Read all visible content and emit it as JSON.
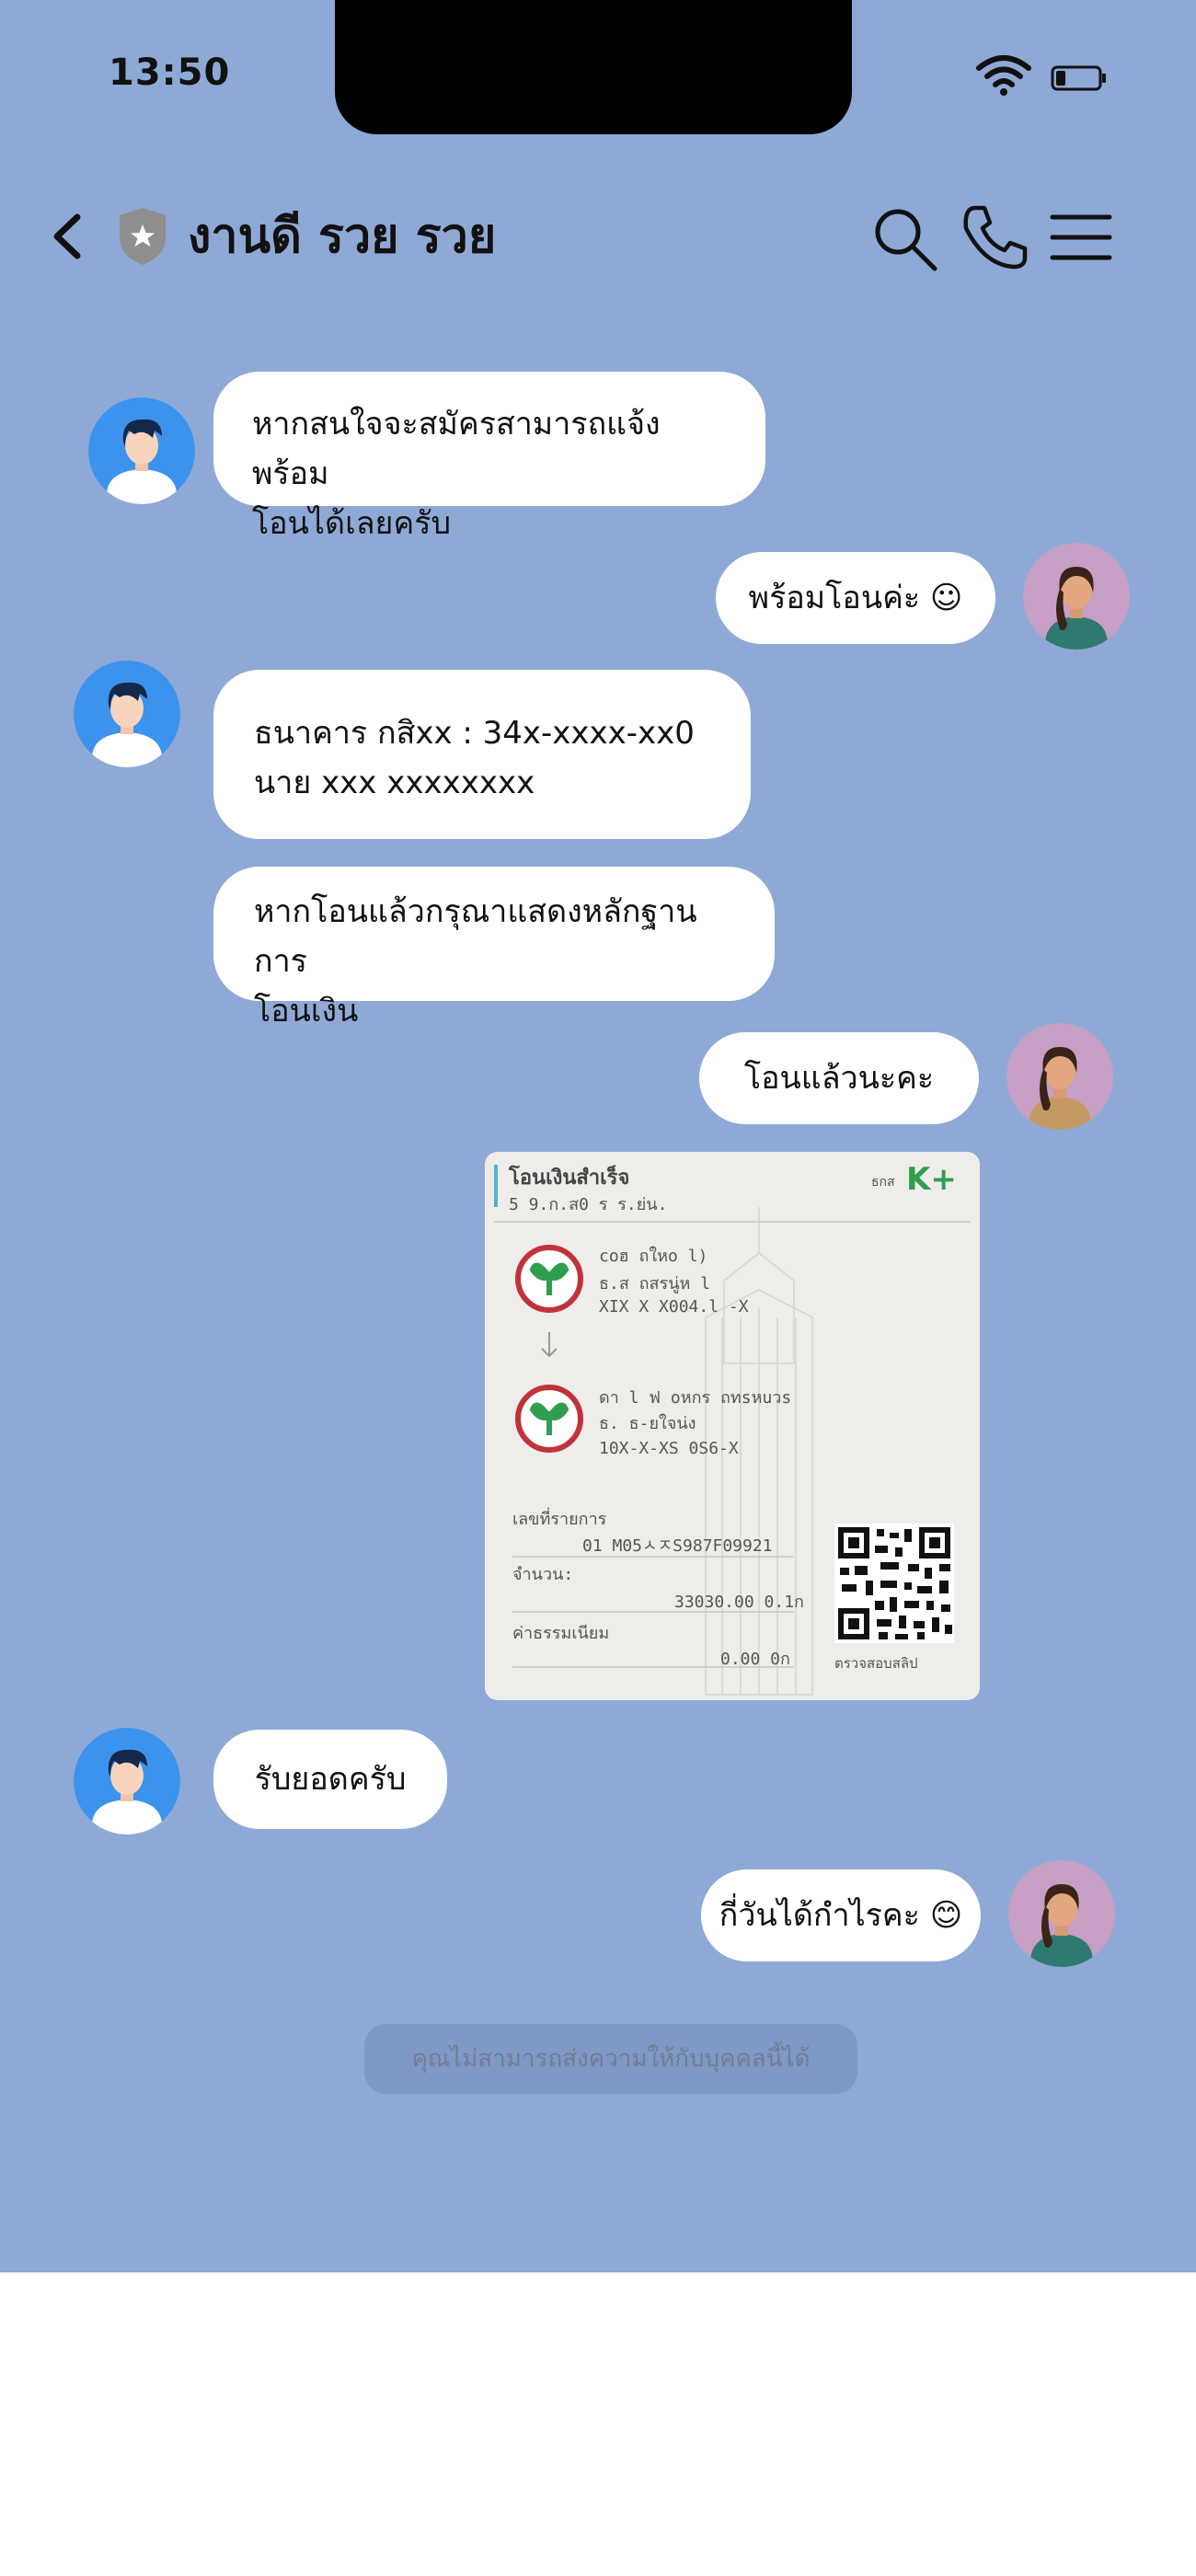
{
  "status_bar": {
    "time": "13:50"
  },
  "header": {
    "title": "งานดี รวย รวย"
  },
  "messages": {
    "m1": "หากสนใจจะสมัครสามารถแจ้งพร้อม\nโอนได้เลยครับ",
    "m2": "พร้อมโอนค่ะ ☺",
    "m3": "ธนาคาร กสิxx : 34x-xxxx-xx0\nนาย xxx xxxxxxxx",
    "m4": "หากโอนแล้วกรุณาแสดงหลักฐานการ\nโอนเงิน",
    "m5": "โอนแล้วนะคะ",
    "m6": "รับยอดครับ",
    "m7": "กี่วันได้กำไรคะ 😊"
  },
  "receipt": {
    "title": "โอนเงินสำเร็จ",
    "date": "5 9.ก.ส0  ร ร.ย่น.",
    "brand": "K+",
    "brand_prefix": "ธกส",
    "from_name": "coฮ ถใหo l)",
    "from_bank": "ธ.ส ถสรนู่ห l",
    "from_acct": "XIX X X004.l -X",
    "to_name": "ดา l ฟ oหกร ถทsหuวs",
    "to_bank": "ธ. ธ-ยใจน่ง",
    "to_acct": "10X-X-XS 0S6-X",
    "ref_label": "เลขที่รายการ",
    "ref_value": "01 M05ㅅㅈS987F09921",
    "amount_label": "จำนวน:",
    "amount_value": "33030.00 0.1ก",
    "fee_label": "ค่าธรรมเนียม",
    "fee_value": "0.00 0ก",
    "qr_caption": "ตรวจสอบสลิป"
  },
  "notice": "คุณไม่สามารถส่งความให้กับบุคคลนี้ได้",
  "colors": {
    "background": "#8fa9d6",
    "bubble": "#ffffff",
    "accent_green": "#2e9e4f"
  }
}
